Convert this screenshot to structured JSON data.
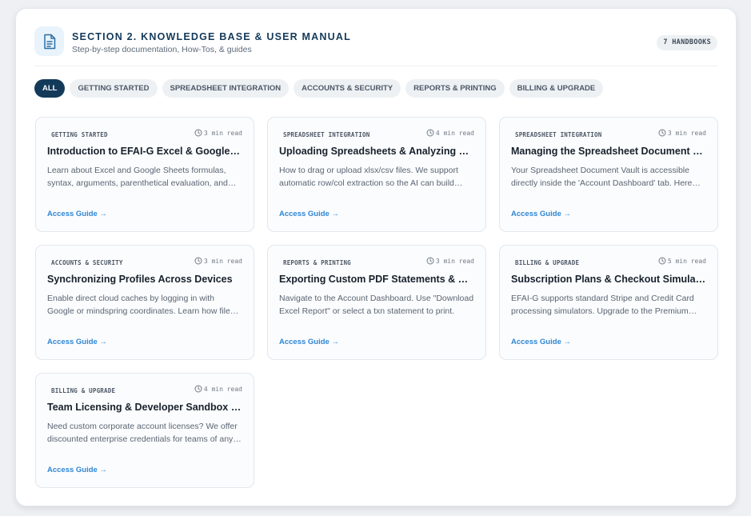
{
  "section": {
    "title": "SECTION 2. KNOWLEDGE BASE & USER MANUAL",
    "subtitle": "Step-by-step documentation, How-Tos, & guides",
    "icon": "document-icon",
    "handbook_count": "7 HANDBOOKS"
  },
  "filters": [
    {
      "label": "ALL",
      "active": true
    },
    {
      "label": "GETTING STARTED",
      "active": false
    },
    {
      "label": "SPREADSHEET INTEGRATION",
      "active": false
    },
    {
      "label": "ACCOUNTS & SECURITY",
      "active": false
    },
    {
      "label": "REPORTS & PRINTING",
      "active": false
    },
    {
      "label": "BILLING & UPGRADE",
      "active": false
    }
  ],
  "colors": {
    "accent": "#143a5a",
    "link": "#2f86d6"
  },
  "guides": [
    {
      "category": "GETTING STARTED",
      "read_time": "3 min read",
      "title": "Introduction to EFAI-G Excel & Google Sheets Formulas",
      "description": "Learn about Excel and Google Sheets formulas, syntax, arguments, parenthetical evaluation, and more.",
      "link": "Access Guide →"
    },
    {
      "category": "SPREADSHEET INTEGRATION",
      "read_time": "4 min read",
      "title": "Uploading Spreadsheets & Analyzing Data",
      "description": "How to drag or upload xlsx/csv files. We support automatic row/col extraction so the AI can build formulas.",
      "link": "Access Guide →"
    },
    {
      "category": "SPREADSHEET INTEGRATION",
      "read_time": "3 min read",
      "title": "Managing the Spreadsheet Document Vault",
      "description": "Your Spreadsheet Document Vault is accessible directly inside the 'Account Dashboard' tab. Here you can manage files.",
      "link": "Access Guide →"
    },
    {
      "category": "ACCOUNTS & SECURITY",
      "read_time": "3 min read",
      "title": "Synchronizing Profiles Across Devices",
      "description": "Enable direct cloud caches by logging in with Google or mindspring coordinates. Learn how file sync works.",
      "link": "Access Guide →"
    },
    {
      "category": "REPORTS & PRINTING",
      "read_time": "3 min read",
      "title": "Exporting Custom PDF Statements & Reports",
      "description": "Navigate to the Account Dashboard. Use \"Download Excel Report\" or select a txn statement to print.",
      "link": "Access Guide →"
    },
    {
      "category": "BILLING & UPGRADE",
      "read_time": "5 min read",
      "title": "Subscription Plans & Checkout Simulators",
      "description": "EFAI-G supports standard Stripe and Credit Card processing simulators. Upgrade to the Premium plan today.",
      "link": "Access Guide →"
    },
    {
      "category": "BILLING & UPGRADE",
      "read_time": "4 min read",
      "title": "Team Licensing & Developer Sandbox Keys",
      "description": "Need custom corporate account licenses? We offer discounted enterprise credentials for teams of any size.",
      "link": "Access Guide →"
    }
  ]
}
